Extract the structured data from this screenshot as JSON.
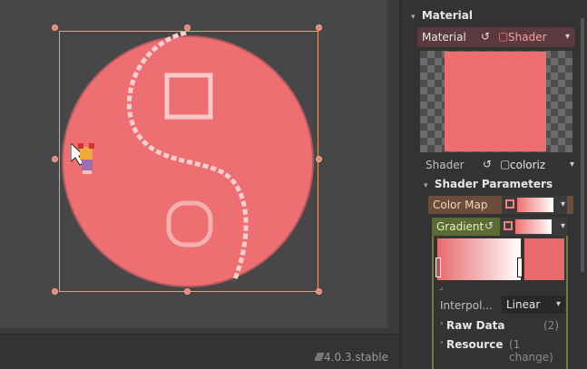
{
  "inspector": {
    "section_material": "Material",
    "material_label": "Material",
    "material_type": "Shader",
    "shader_label": "Shader",
    "shader_value": "coloriz",
    "section_params": "Shader Parameters",
    "color_map_label": "Color Map",
    "gradient_label": "Gradient",
    "interpolation_label": "Interpol...",
    "interpolation_value": "Linear",
    "raw_data_label": "Raw Data",
    "raw_data_count": "(2)",
    "resource_label": "Resource",
    "resource_changes": "(1 change)"
  },
  "statusbar": {
    "version": "4.0.3.stable"
  },
  "colors": {
    "shape_fill": "#ee6f72",
    "selection": "#e0a27a",
    "accent_red": "#f08080"
  },
  "icons": [
    "reload-icon",
    "shader-icon",
    "chevron-down-icon",
    "texture-icon",
    "gradient-icon",
    "bell-icon"
  ]
}
